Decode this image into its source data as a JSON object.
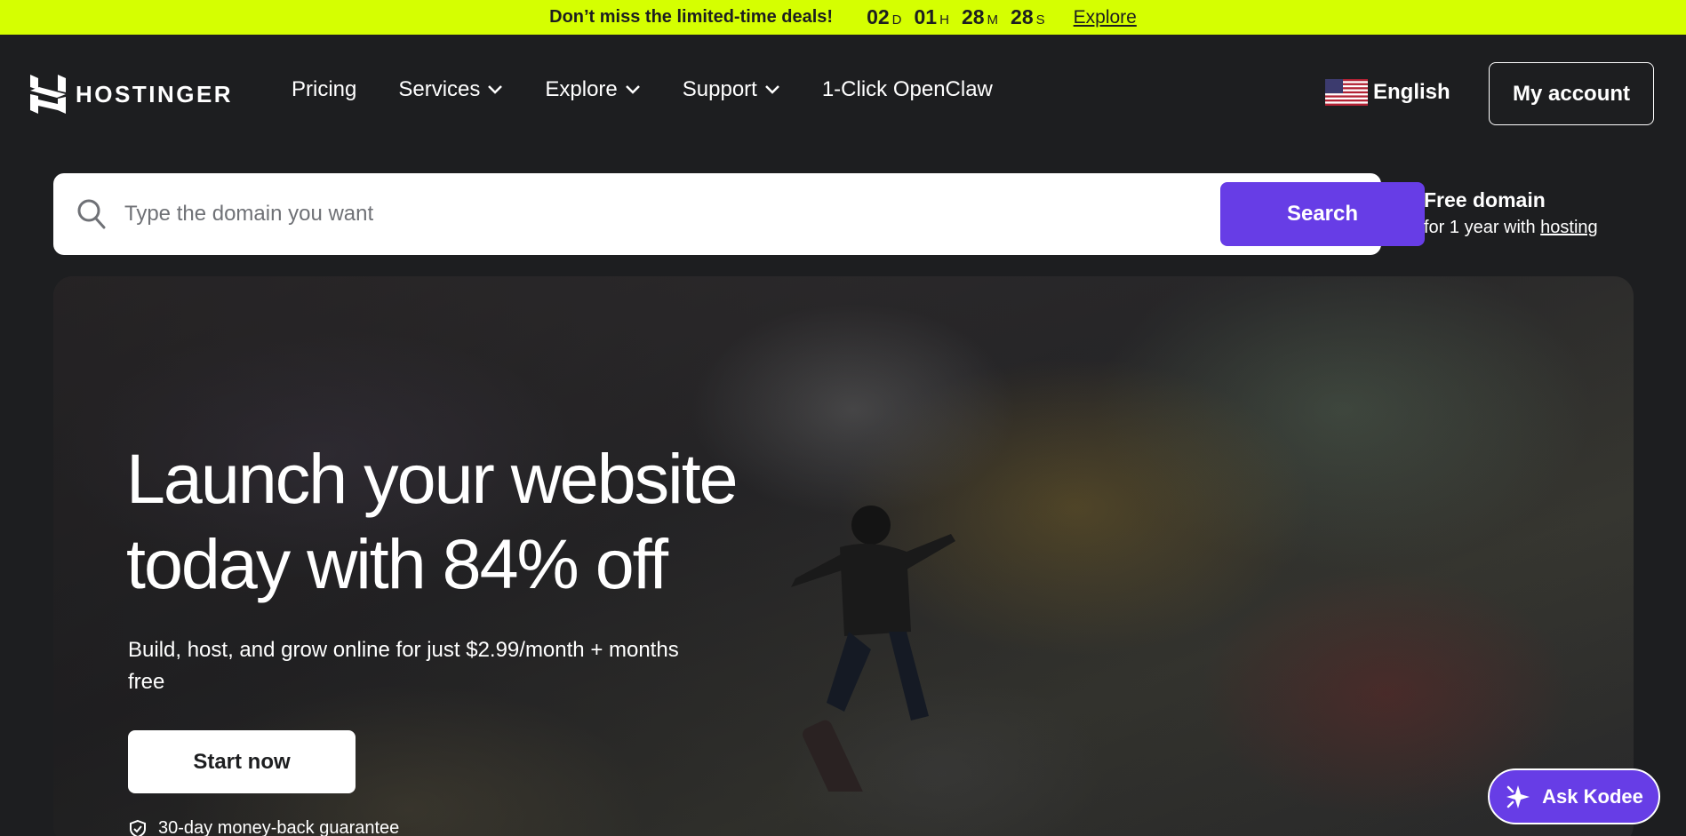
{
  "promo": {
    "message": "Don’t miss the limited-time deals!",
    "countdown": [
      {
        "value": "02",
        "suffix": "D"
      },
      {
        "value": "01",
        "suffix": "H"
      },
      {
        "value": "28",
        "suffix": "M"
      },
      {
        "value": "28",
        "suffix": "S"
      }
    ],
    "link": "Explore",
    "color": "#d5ff01"
  },
  "header": {
    "brand": "HOSTINGER",
    "nav": [
      {
        "label": "Pricing",
        "dropdown": false
      },
      {
        "label": "Services",
        "dropdown": true
      },
      {
        "label": "Explore",
        "dropdown": true
      },
      {
        "label": "Support",
        "dropdown": true
      },
      {
        "label": "1-Click OpenClaw",
        "dropdown": false
      }
    ],
    "language": "English",
    "account": "My account"
  },
  "search": {
    "placeholder": "Type the domain you want",
    "button": "Search",
    "accent": "#673de6"
  },
  "free_domain": {
    "title": "Free domain",
    "text": "for 1 year with",
    "link": "hosting"
  },
  "hero": {
    "title_line1": "Launch your website",
    "title_line2": "today with 84% off",
    "subtitle": "Build, host, and grow online for just $2.99/month + months free",
    "cta": "Start now",
    "guarantee": "30-day money-back guarantee"
  },
  "assistant": {
    "label": "Ask Kodee"
  }
}
